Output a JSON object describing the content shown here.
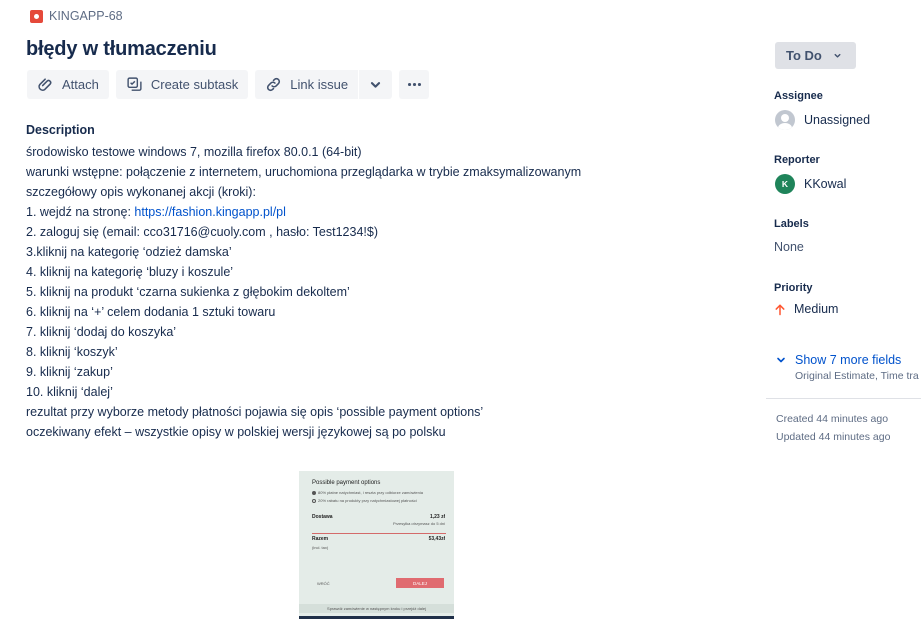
{
  "issue": {
    "key": "KINGAPP-68",
    "summary": "błędy w tłumaczeniu"
  },
  "toolbar": {
    "attach": "Attach",
    "create_subtask": "Create subtask",
    "link_issue": "Link issue"
  },
  "description": {
    "title": "Description",
    "lines": [
      "środowisko testowe windows 7, mozilla firefox 80.0.1 (64-bit)",
      "warunki wstępne: połączenie z internetem, uruchomiona przeglądarka w trybie zmaksymalizowanym",
      "szczegółowy opis wykonanej akcji (kroki):",
      "1. wejdź na stronę: ",
      "2. zaloguj się (email: cco31716@cuoly.com , hasło: Test1234!$)",
      "3.kliknij na kategorię ‘odzież damska’",
      "4. kliknij na kategorię ‘bluzy i koszule’",
      "5. kliknij na produkt ‘czarna sukienka z głębokim dekoltem’",
      "6. kliknij na ‘+’ celem dodania 1 sztuki towaru",
      "7.  kliknij ‘dodaj do koszyka’",
      "8. kliknij ‘koszyk’",
      "9. kliknij ‘zakup’",
      "10. kliknij ‘dalej’",
      "rezultat przy wyborze metody płatności pojawia się opis ‘possible payment options’",
      "oczekiwany efekt – wszystkie opisy w polskiej wersji językowej są po polsku"
    ],
    "link": "https://fashion.kingapp.pl/pl"
  },
  "attachment": {
    "title": "Possible payment options",
    "option1": "80% płatne natychmiast, i reszta przy odbiorze zamówienia",
    "option2": "20% rabatu na produkty przy natychmiastowej płatności",
    "delivery_label": "Dostawa",
    "delivery_value": "1,23 zł",
    "delivery_note": "Przesyłka otrzymasz do 5 dni",
    "total_label": "Razem",
    "total_value": "53,43zł",
    "total_note": "(incl. tax)",
    "back": "WRÓĆ",
    "next": "DALEJ",
    "footer": "Sprawdź zamówienie w następnym kroku i przejdź dalej"
  },
  "sidebar": {
    "status": "To Do",
    "assignee_label": "Assignee",
    "assignee": "Unassigned",
    "reporter_label": "Reporter",
    "reporter": "KKowal",
    "reporter_initial": "K",
    "labels_label": "Labels",
    "labels_value": "None",
    "priority_label": "Priority",
    "priority": "Medium",
    "more_fields": "Show 7 more fields",
    "more_fields_sub": "Original Estimate, Time tra",
    "created": "Created 44 minutes ago",
    "updated": "Updated 44 minutes ago"
  }
}
